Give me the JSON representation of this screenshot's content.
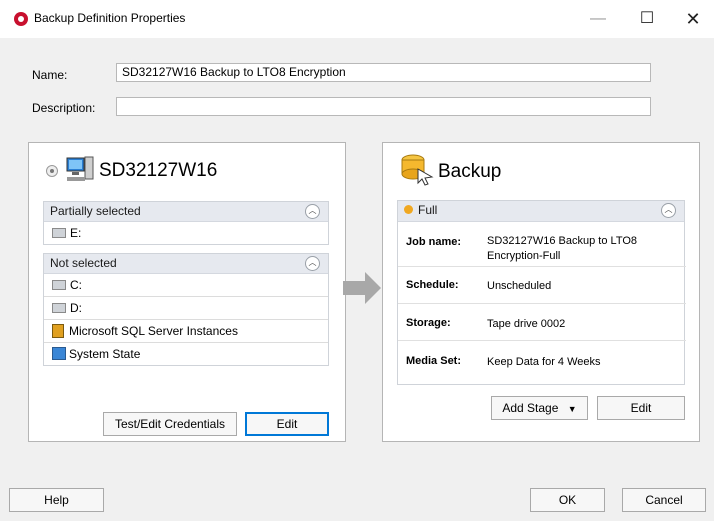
{
  "window": {
    "title": "Backup Definition Properties"
  },
  "form": {
    "name_label": "Name:",
    "name_value": "SD32127W16 Backup to LTO8 Encryption",
    "description_label": "Description:",
    "description_value": ""
  },
  "source": {
    "server_name": "SD32127W16",
    "partial_header": "Partially selected",
    "partial_items": [
      "E:"
    ],
    "not_selected_header": "Not selected",
    "not_selected_items": [
      "C:",
      "D:",
      "Microsoft SQL Server Instances",
      "System State"
    ],
    "test_button": "Test/Edit Credentials",
    "edit_button": "Edit"
  },
  "stage": {
    "title": "Backup",
    "stage_label": "Full",
    "job_name_label": "Job name:",
    "job_name_value_1": "SD32127W16 Backup to LTO8",
    "job_name_value_2": "Encryption-Full",
    "schedule_label": "Schedule:",
    "schedule_value": "Unscheduled",
    "storage_label": "Storage:",
    "storage_value": "Tape drive 0002",
    "mediaset_label": "Media Set:",
    "mediaset_value": "Keep Data for 4 Weeks",
    "add_stage_button": "Add Stage",
    "edit_button": "Edit"
  },
  "footer": {
    "help": "Help",
    "ok": "OK",
    "cancel": "Cancel"
  },
  "colors": {
    "accent": "#0078d7",
    "app_icon": "#c8102e",
    "arrow": "#a8a8a8"
  }
}
